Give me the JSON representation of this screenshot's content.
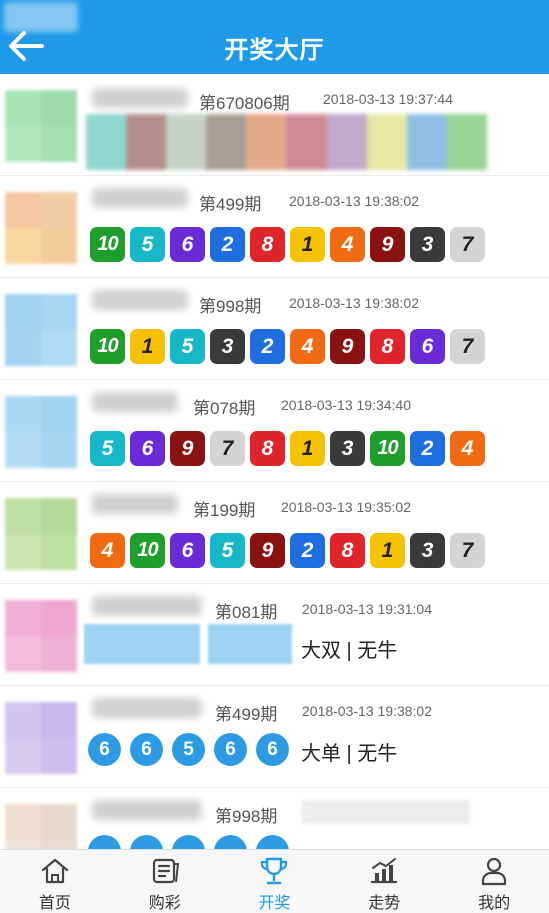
{
  "header": {
    "title": "开奖大厅"
  },
  "colors": {
    "accent": "#1f9ae8",
    "green": "#1e9e2a",
    "cyan": "#16b8c8",
    "purple": "#6a2bd6",
    "blue": "#1e6ee0",
    "red": "#e0242c",
    "yellow": "#f4c200",
    "orange": "#f06a12",
    "maroon": "#8a1210",
    "dark": "#3a3a3a",
    "grey": "#d4d4d4"
  },
  "lotteries": [
    {
      "period": "第670806期",
      "time": "2018-03-13 19:37:44"
    },
    {
      "period": "第499期",
      "time": "2018-03-13 19:38:02",
      "balls": [
        "10",
        "5",
        "6",
        "2",
        "8",
        "1",
        "4",
        "9",
        "3",
        "7"
      ]
    },
    {
      "period": "第998期",
      "time": "2018-03-13 19:38:02",
      "balls": [
        "10",
        "1",
        "5",
        "3",
        "2",
        "4",
        "9",
        "8",
        "6",
        "7"
      ]
    },
    {
      "period": "第078期",
      "time": "2018-03-13 19:34:40",
      "balls": [
        "5",
        "6",
        "9",
        "7",
        "8",
        "1",
        "3",
        "10",
        "2",
        "4"
      ]
    },
    {
      "period": "第199期",
      "time": "2018-03-13 19:35:02",
      "balls": [
        "4",
        "10",
        "6",
        "5",
        "9",
        "2",
        "8",
        "1",
        "3",
        "7"
      ]
    },
    {
      "period": "第081期",
      "time": "2018-03-13 19:31:04",
      "result": "大双 | 无牛"
    },
    {
      "period": "第499期",
      "time": "2018-03-13 19:38:02",
      "circles": [
        "6",
        "6",
        "5",
        "6",
        "6"
      ],
      "result": "大单 | 无牛"
    },
    {
      "period": "第998期"
    }
  ],
  "tabbar": {
    "items": [
      {
        "label": "首页",
        "icon": "home-icon"
      },
      {
        "label": "购彩",
        "icon": "lottery-ticket-icon"
      },
      {
        "label": "开奖",
        "icon": "trophy-icon",
        "active": true
      },
      {
        "label": "走势",
        "icon": "trend-chart-icon"
      },
      {
        "label": "我的",
        "icon": "user-icon"
      }
    ]
  }
}
